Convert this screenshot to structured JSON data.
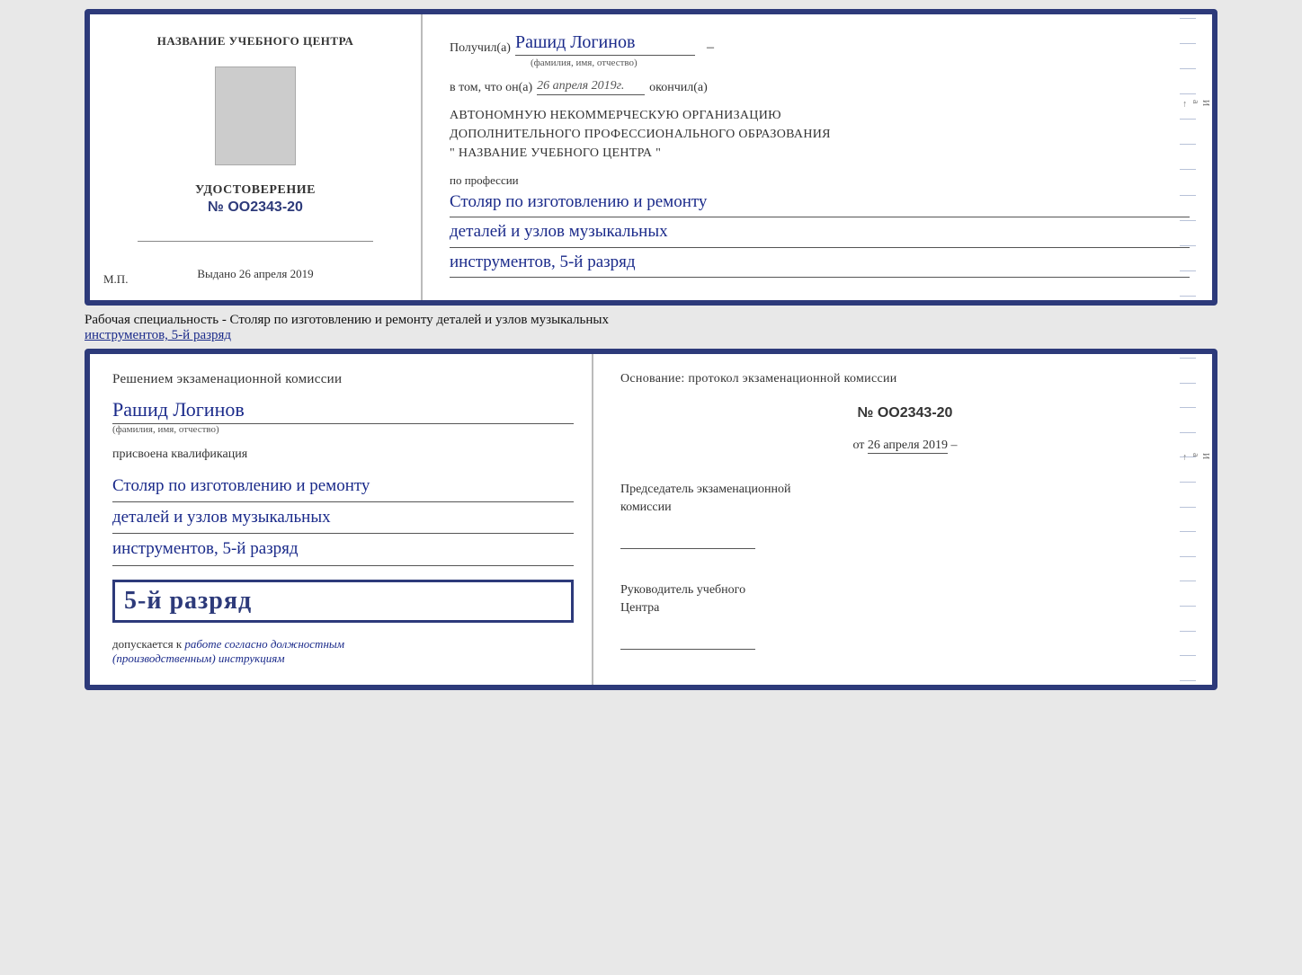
{
  "top_cert": {
    "left": {
      "center_name": "НАЗВАНИЕ УЧЕБНОГО ЦЕНТРА",
      "cert_title": "УДОСТОВЕРЕНИЕ",
      "cert_number": "№ OO2343-20",
      "issued_label": "Выдано",
      "issued_date": "26 апреля 2019",
      "mp_label": "М.П."
    },
    "right": {
      "received_label": "Получил(а)",
      "recipient_name": "Рашид Логинов",
      "fio_subtitle": "(фамилия, имя, отчество)",
      "in_that_label": "в том, что он(а)",
      "date_value": "26 апреля 2019г.",
      "finished_label": "окончил(а)",
      "org_line1": "АВТОНОМНУЮ НЕКОММЕРЧЕСКУЮ ОРГАНИЗАЦИЮ",
      "org_line2": "ДОПОЛНИТЕЛЬНОГО ПРОФЕССИОНАЛЬНОГО ОБРАЗОВАНИЯ",
      "org_quote": "\"  НАЗВАНИЕ УЧЕБНОГО ЦЕНТРА  \"",
      "profession_label": "по профессии",
      "profession_line1": "Столяр по изготовлению и ремонту",
      "profession_line2": "деталей и узлов музыкальных",
      "profession_line3": "инструментов, 5-й разряд"
    }
  },
  "specialty_label": "Рабочая специальность - Столяр по изготовлению и ремонту деталей и узлов музыкальных",
  "specialty_label2": "инструментов, 5-й разряд",
  "bottom_cert": {
    "left": {
      "decision_text": "Решением экзаменационной комиссии",
      "person_name": "Рашид Логинов",
      "fio_subtitle": "(фамилия, имя, отчество)",
      "assigned_label": "присвоена квалификация",
      "qualification_line1": "Столяр по изготовлению и ремонту",
      "qualification_line2": "деталей и узлов музыкальных",
      "qualification_line3": "инструментов, 5-й разряд",
      "grade_text": "5-й разряд",
      "allowed_label": "допускается к",
      "allowed_text": "работе согласно должностным",
      "allowed_text2": "(производственным) инструкциям"
    },
    "right": {
      "basis_label": "Основание: протокол экзаменационной комиссии",
      "protocol_num": "№  OO2343-20",
      "from_label": "от",
      "from_date": "26 апреля 2019",
      "chairman_label": "Председатель экзаменационной",
      "chairman_label2": "комиссии",
      "director_label": "Руководитель учебного",
      "director_label2": "Центра"
    }
  },
  "side_labels": {
    "И": "И",
    "а": "а",
    "arrow": "←",
    "dash1": "–",
    "dash2": "–",
    "dash3": "–",
    "dash4": "–",
    "dash5": "–",
    "dash6": "–"
  }
}
